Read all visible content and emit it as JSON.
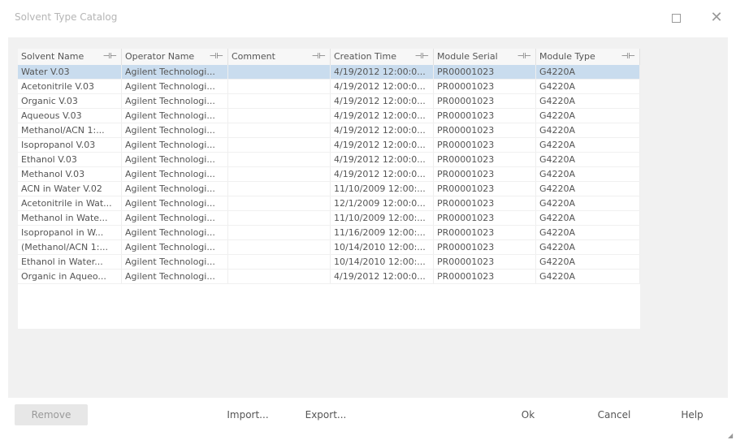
{
  "window": {
    "title": "Solvent Type Catalog"
  },
  "grid": {
    "columns": [
      "Solvent Name",
      "Operator Name",
      "Comment",
      "Creation Time",
      "Module Serial",
      "Module Type"
    ],
    "rows": [
      [
        "Water V.03",
        "Agilent Technologi...",
        "",
        "4/19/2012 12:00:0...",
        "PR00001023",
        "G4220A"
      ],
      [
        "Acetonitrile V.03",
        "Agilent Technologi...",
        "",
        "4/19/2012 12:00:0...",
        "PR00001023",
        "G4220A"
      ],
      [
        "Organic V.03",
        "Agilent Technologi...",
        "",
        "4/19/2012 12:00:0...",
        "PR00001023",
        "G4220A"
      ],
      [
        "Aqueous V.03",
        "Agilent Technologi...",
        "",
        "4/19/2012 12:00:0...",
        "PR00001023",
        "G4220A"
      ],
      [
        "Methanol/ACN 1:...",
        "Agilent Technologi...",
        "",
        "4/19/2012 12:00:0...",
        "PR00001023",
        "G4220A"
      ],
      [
        "Isopropanol V.03",
        "Agilent Technologi...",
        "",
        "4/19/2012 12:00:0...",
        "PR00001023",
        "G4220A"
      ],
      [
        "Ethanol V.03",
        "Agilent Technologi...",
        "",
        "4/19/2012 12:00:0...",
        "PR00001023",
        "G4220A"
      ],
      [
        "Methanol V.03",
        "Agilent Technologi...",
        "",
        "4/19/2012 12:00:0...",
        "PR00001023",
        "G4220A"
      ],
      [
        "ACN in Water V.02",
        "Agilent Technologi...",
        "",
        "11/10/2009 12:00:...",
        "PR00001023",
        "G4220A"
      ],
      [
        "Acetonitrile in Wat...",
        "Agilent Technologi...",
        "",
        "12/1/2009 12:00:0...",
        "PR00001023",
        "G4220A"
      ],
      [
        "Methanol in Wate...",
        "Agilent Technologi...",
        "",
        "11/10/2009 12:00:...",
        "PR00001023",
        "G4220A"
      ],
      [
        "Isopropanol in W...",
        "Agilent Technologi...",
        "",
        "11/16/2009 12:00:...",
        "PR00001023",
        "G4220A"
      ],
      [
        "(Methanol/ACN 1:...",
        "Agilent Technologi...",
        "",
        "10/14/2010 12:00:...",
        "PR00001023",
        "G4220A"
      ],
      [
        "Ethanol in Water...",
        "Agilent Technologi...",
        "",
        "10/14/2010 12:00:...",
        "PR00001023",
        "G4220A"
      ],
      [
        "Organic in Aqueo...",
        "Agilent Technologi...",
        "",
        "4/19/2012 12:00:0...",
        "PR00001023",
        "G4220A"
      ]
    ],
    "selected_row": 0,
    "pin_icon": "pin-icon"
  },
  "buttons": {
    "remove": "Remove",
    "import": "Import...",
    "export": "Export...",
    "ok": "Ok",
    "cancel": "Cancel",
    "help": "Help"
  },
  "colors": {
    "selection": "#c9dcee",
    "content_bg": "#f1f1f1"
  }
}
